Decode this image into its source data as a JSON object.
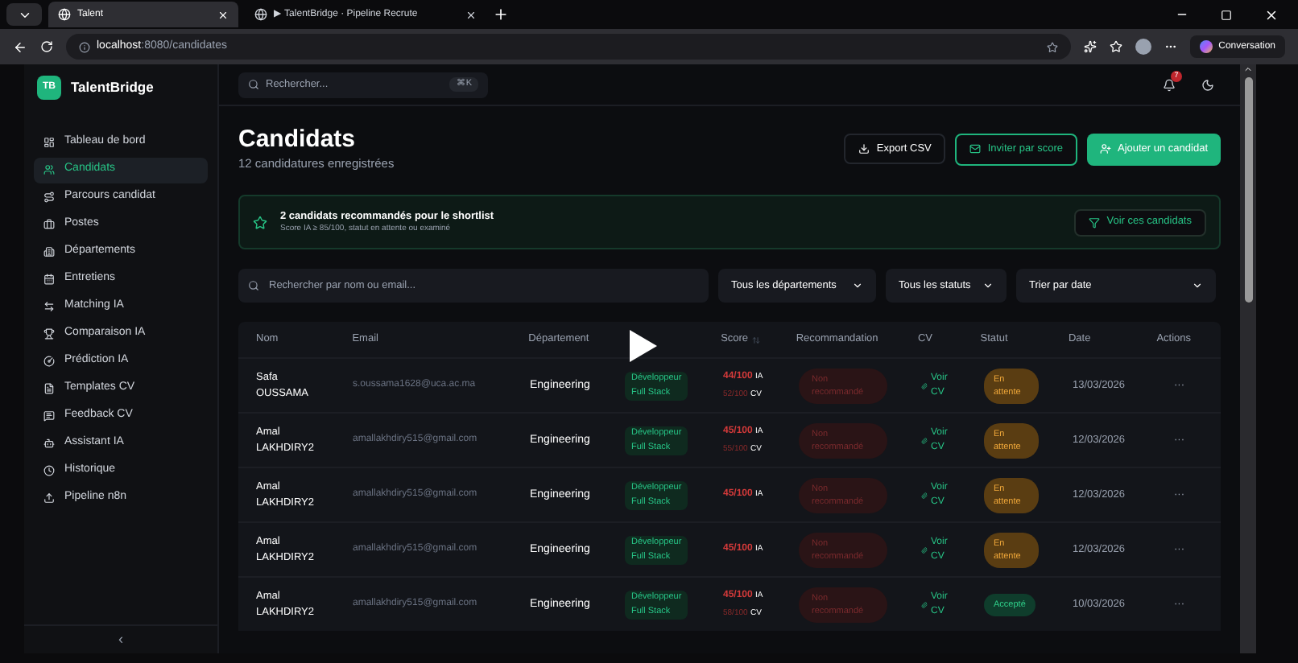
{
  "browser": {
    "tabs": [
      {
        "title": "Talent",
        "selected": true
      },
      {
        "title": "▶ TalentBridge · Pipeline Recrute",
        "selected": false
      }
    ],
    "url_host": "localhost",
    "url_path": ":8080/candidates",
    "copilot": "Conversation"
  },
  "sidebar": {
    "brand_badge": "TB",
    "brand": "TalentBridge",
    "items": [
      {
        "label": "Tableau de bord",
        "selected": false
      },
      {
        "label": "Candidats",
        "selected": true
      },
      {
        "label": "Parcours candidat",
        "selected": false
      },
      {
        "label": "Postes",
        "selected": false
      },
      {
        "label": "Départements",
        "selected": false
      },
      {
        "label": "Entretiens",
        "selected": false
      },
      {
        "label": "Matching IA",
        "selected": false
      },
      {
        "label": "Comparaison IA",
        "selected": false
      },
      {
        "label": "Prédiction IA",
        "selected": false
      },
      {
        "label": "Templates CV",
        "selected": false
      },
      {
        "label": "Feedback CV",
        "selected": false
      },
      {
        "label": "Assistant IA",
        "selected": false
      },
      {
        "label": "Historique",
        "selected": false
      },
      {
        "label": "Pipeline n8n",
        "selected": false
      }
    ],
    "collapse": "‹"
  },
  "topbar": {
    "search_placeholder": "Rechercher...",
    "shortcut": "⌘K",
    "notifications": "7"
  },
  "header": {
    "title": "Candidats",
    "subtitle": "12 candidatures enregistrées",
    "buttons": [
      "Export CSV",
      "Inviter par score",
      "Ajouter un candidat"
    ]
  },
  "shortlist": {
    "title": "2 candidats recommandés pour le shortlist",
    "detail": "Score IA ≥ 85/100, statut en attente ou examiné",
    "button": "Voir ces candidats"
  },
  "filters": {
    "search_placeholder": "Rechercher par nom ou email...",
    "selects": [
      "Tous les départements",
      "Tous les statuts",
      "Trier par date"
    ]
  },
  "table": {
    "columns": [
      "Nom",
      "Email",
      "Département",
      "Score",
      "Recommandation",
      "CV",
      "Statut",
      "Date",
      "Actions"
    ],
    "rows": [
      {
        "first": "Safa",
        "last": "OUSSAMA",
        "email": "s.oussama1628@uca.ac.ma",
        "department": "Engineering",
        "post": [
          "Développeur",
          "Full Stack"
        ],
        "score_ia": {
          "value": "44/100",
          "label": "IA"
        },
        "score_cv": {
          "value": "52/100",
          "label": "CV"
        },
        "recommendation": "Non recommandé",
        "cv": [
          "Voir",
          "CV"
        ],
        "status": {
          "label": "En attente",
          "kind": "pending"
        },
        "date": "13/03/2026",
        "actions": "···"
      },
      {
        "first": "Amal",
        "last": "LAKHDIRY2",
        "email": "amallakhdiry515@gmail.com",
        "department": "Engineering",
        "post": [
          "Développeur",
          "Full Stack"
        ],
        "score_ia": {
          "value": "45/100",
          "label": "IA"
        },
        "score_cv": {
          "value": "55/100",
          "label": "CV"
        },
        "recommendation": "Non recommandé",
        "cv": [
          "Voir",
          "CV"
        ],
        "status": {
          "label": "En attente",
          "kind": "pending"
        },
        "date": "12/03/2026",
        "actions": "···"
      },
      {
        "first": "Amal",
        "last": "LAKHDIRY2",
        "email": "amallakhdiry515@gmail.com",
        "department": "Engineering",
        "post": [
          "Développeur",
          "Full Stack"
        ],
        "score_ia": {
          "value": "45/100",
          "label": "IA"
        },
        "recommendation": "Non recommandé",
        "cv": [
          "Voir",
          "CV"
        ],
        "status": {
          "label": "En attente",
          "kind": "pending"
        },
        "date": "12/03/2026",
        "actions": "···"
      },
      {
        "first": "Amal",
        "last": "LAKHDIRY2",
        "email": "amallakhdiry515@gmail.com",
        "department": "Engineering",
        "post": [
          "Développeur",
          "Full Stack"
        ],
        "score_ia": {
          "value": "45/100",
          "label": "IA"
        },
        "recommendation": "Non recommandé",
        "cv": [
          "Voir",
          "CV"
        ],
        "status": {
          "label": "En attente",
          "kind": "pending"
        },
        "date": "12/03/2026",
        "actions": "···"
      },
      {
        "first": "Amal",
        "last": "LAKHDIRY2",
        "email": "amallakhdiry515@gmail.com",
        "department": "Engineering",
        "post": [
          "Développeur",
          "Full Stack"
        ],
        "score_ia": {
          "value": "45/100",
          "label": "IA"
        },
        "score_cv": {
          "value": "58/100",
          "label": "CV"
        },
        "recommendation": "Non recommandé",
        "cv": [
          "Voir",
          "CV"
        ],
        "status": {
          "label": "Accepté",
          "kind": "accepted"
        },
        "date": "10/03/2026",
        "actions": "···"
      }
    ]
  }
}
